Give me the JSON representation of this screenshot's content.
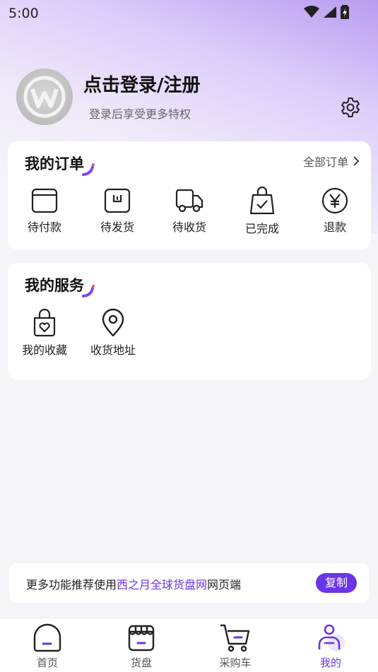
{
  "status_bar": {
    "time": "5:00"
  },
  "profile": {
    "title": "点击登录/注册",
    "subtitle": "登录后享受更多特权"
  },
  "orders": {
    "title": "我的订单",
    "all_label": "全部订单",
    "items": [
      {
        "label": "待付款",
        "icon": "wallet-icon"
      },
      {
        "label": "待发货",
        "icon": "package-box-icon"
      },
      {
        "label": "待收货",
        "icon": "delivery-truck-icon"
      },
      {
        "label": "已完成",
        "icon": "shopping-bag-check-icon"
      },
      {
        "label": "退款",
        "icon": "yen-circle-icon"
      }
    ]
  },
  "services": {
    "title": "我的服务",
    "items": [
      {
        "label": "我的收藏",
        "icon": "heart-bag-icon"
      },
      {
        "label": "收货地址",
        "icon": "location-pin-icon"
      }
    ]
  },
  "promo": {
    "prefix": "更多功能推荐使用",
    "link": "西之月全球货盘网",
    "suffix": "网页端",
    "button": "复制"
  },
  "tabbar": {
    "items": [
      {
        "label": "首页",
        "icon": "home-icon",
        "active": false
      },
      {
        "label": "货盘",
        "icon": "store-icon",
        "active": false
      },
      {
        "label": "采购车",
        "icon": "cart-icon",
        "active": false
      },
      {
        "label": "我的",
        "icon": "user-icon",
        "active": true
      }
    ]
  },
  "colors": {
    "accent": "#6a35e8",
    "background": "#f4f4f9",
    "header_gradient_top": "#b99cf0"
  }
}
